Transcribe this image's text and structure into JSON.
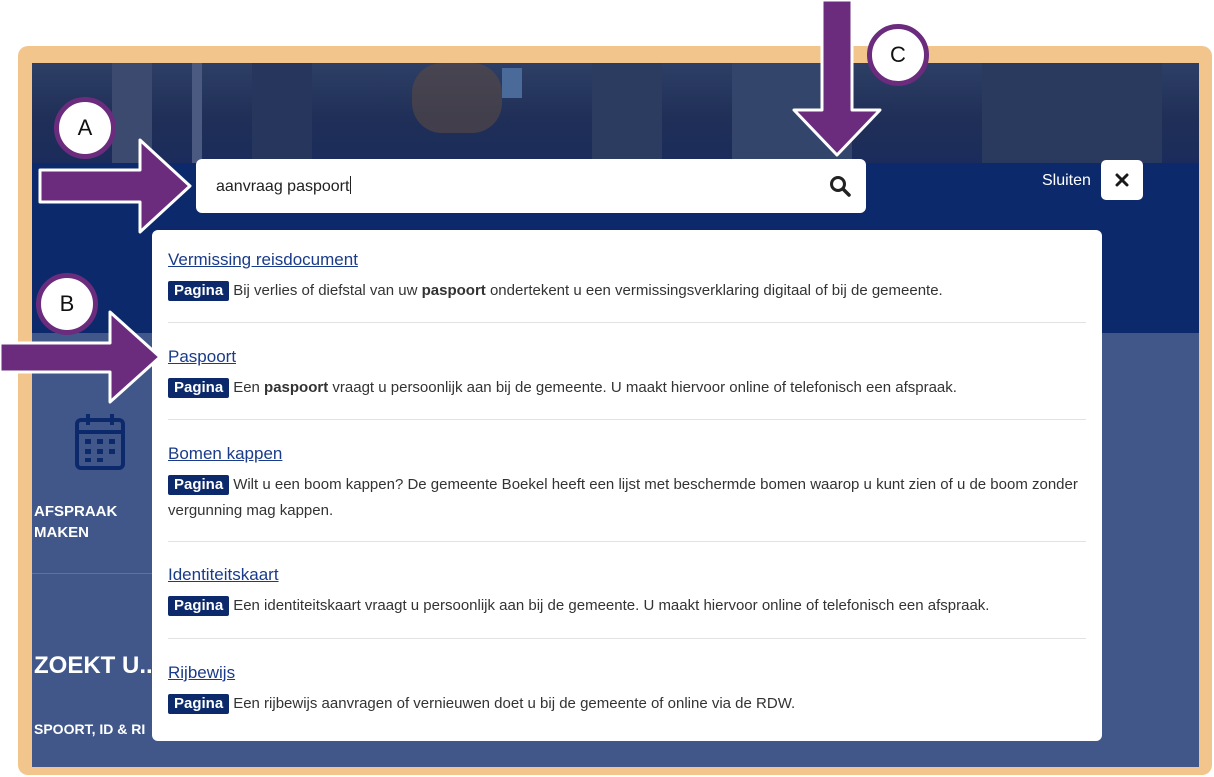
{
  "search": {
    "query": "aanvraag paspoort",
    "close_label": "Sluiten"
  },
  "results": [
    {
      "title": "Vermissing reisdocument",
      "badge": "Pagina",
      "desc_pre": "Bij verlies of diefstal van uw ",
      "desc_bold": "paspoort",
      "desc_post": " ondertekent u een vermissingsverklaring digitaal of bij de gemeente."
    },
    {
      "title": "Paspoort",
      "badge": "Pagina",
      "desc_pre": "Een ",
      "desc_bold": "paspoort",
      "desc_post": " vraagt u persoonlijk aan bij de gemeente. U maakt hiervoor online of telefonisch een afspraak."
    },
    {
      "title": "Bomen kappen",
      "badge": "Pagina",
      "desc_pre": "Wilt u een boom kappen? De gemeente Boekel heeft een lijst met beschermde bomen waarop u kunt zien of u de boom zonder vergunning mag kappen.",
      "desc_bold": "",
      "desc_post": ""
    },
    {
      "title": "Identiteitskaart",
      "badge": "Pagina",
      "desc_pre": "Een identiteitskaart vraagt u persoonlijk aan bij de gemeente. U maakt hiervoor online of telefonisch een afspraak.",
      "desc_bold": "",
      "desc_post": ""
    },
    {
      "title": "Rijbewijs",
      "badge": "Pagina",
      "desc_pre": "Een rijbewijs aanvragen of vernieuwen doet u bij de gemeente of online via de RDW.",
      "desc_bold": "",
      "desc_post": ""
    }
  ],
  "background": {
    "afspraak_line1": "AFSPRAAK",
    "afspraak_line2": "MAKEN",
    "zoekt_heading": "ZOEKT U...",
    "paspoort_link": "SPOORT, ID & RI"
  },
  "markers": {
    "a": "A",
    "b": "B",
    "c": "C"
  },
  "colors": {
    "frame": "#f2c58d",
    "navy": "#0c2a6b",
    "arrow": "#6b2c7d",
    "link": "#1a3b8a"
  }
}
